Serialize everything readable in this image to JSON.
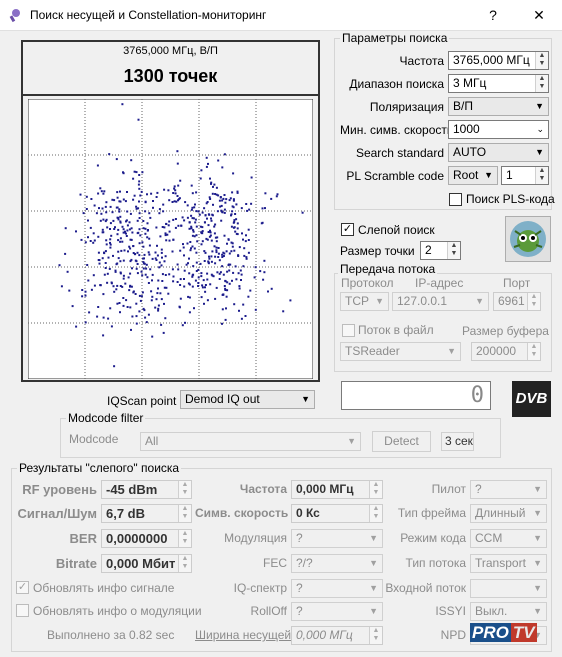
{
  "window": {
    "title": "Поиск несущей и Constellation-мониторинг",
    "help": "?",
    "close": "✕"
  },
  "constellation": {
    "freq_label": "3765,000 МГц, В/П",
    "points_label": "1300 точек",
    "points": 1300
  },
  "search_params": {
    "group_title": "Параметры поиска",
    "frequency": {
      "label": "Частота",
      "value": "3765,000 МГц"
    },
    "range": {
      "label": "Диапазон поиска",
      "value": "3 МГц"
    },
    "polarization": {
      "label": "Поляризация",
      "value": "В/П"
    },
    "min_sr": {
      "label": "Мин. симв. скорость",
      "value": "1000"
    },
    "standard": {
      "label": "Search standard",
      "value": "AUTO"
    },
    "pls": {
      "label": "PL Scramble code",
      "mode": "Root",
      "value": "1"
    },
    "pls_search": {
      "label": "Поиск PLS-кода",
      "checked": false
    }
  },
  "blind": {
    "label": "Слепой поиск",
    "checked": true,
    "point_size_label": "Размер точки",
    "point_size": "2"
  },
  "stream": {
    "group_title": "Передача потока",
    "protocol_label": "Протокол",
    "ip_label": "IP-адрес",
    "port_label": "Порт",
    "protocol": "TCP",
    "ip": "127.0.0.1",
    "port": "6961",
    "to_file_label": "Поток в файл",
    "buffer_label": "Размер буфера",
    "reader": "TSReader",
    "buffer": "200000"
  },
  "counter": "0",
  "dvb_logo": "DVB",
  "iqscan": {
    "label": "IQScan point",
    "value": "Demod IQ out"
  },
  "modcode": {
    "group_title": "Modcode filter",
    "label": "Modcode",
    "value": "All",
    "detect": "Detect",
    "timeout": "3 сек"
  },
  "results": {
    "group_title": "Результаты \"слепого\" поиска",
    "rf_level": {
      "label": "RF уровень",
      "value": "-45 dBm"
    },
    "snr": {
      "label": "Сигнал/Шум",
      "value": "6,7 dB"
    },
    "ber": {
      "label": "BER",
      "value": "0,0000000"
    },
    "bitrate": {
      "label": "Bitrate",
      "value": "0,000 Мбит"
    },
    "freq": {
      "label": "Частота",
      "value": "0,000 МГц"
    },
    "sr": {
      "label": "Симв. скорость",
      "value": "0 Кс"
    },
    "modulation": {
      "label": "Модуляция",
      "value": "?"
    },
    "fec": {
      "label": "FEC",
      "value": "?/?"
    },
    "iq": {
      "label": "IQ-спектр",
      "value": "?"
    },
    "rolloff": {
      "label": "RollOff",
      "value": "?"
    },
    "width": {
      "label": "Ширина несущей",
      "value": "0,000 МГц"
    },
    "pilot": {
      "label": "Пилот",
      "value": "?"
    },
    "frame": {
      "label": "Тип фрейма",
      "value": "Длинный"
    },
    "code_mode": {
      "label": "Режим кода",
      "value": "CCM"
    },
    "stream_type": {
      "label": "Тип потока",
      "value": "Transport"
    },
    "input_stream": {
      "label": "Входной поток",
      "value": ""
    },
    "issyi": {
      "label": "ISSYI",
      "value": "Выкл."
    },
    "npd": {
      "label": "NPD",
      "value": ""
    },
    "update_signal": {
      "label": "Обновлять инфо сигнале",
      "checked": true
    },
    "update_mod": {
      "label": "Обновлять инфо о модуляции",
      "checked": false
    },
    "done": "Выполнено за 0.82 sec"
  },
  "watermark": {
    "pro": "PRO",
    "tv": "TV"
  }
}
